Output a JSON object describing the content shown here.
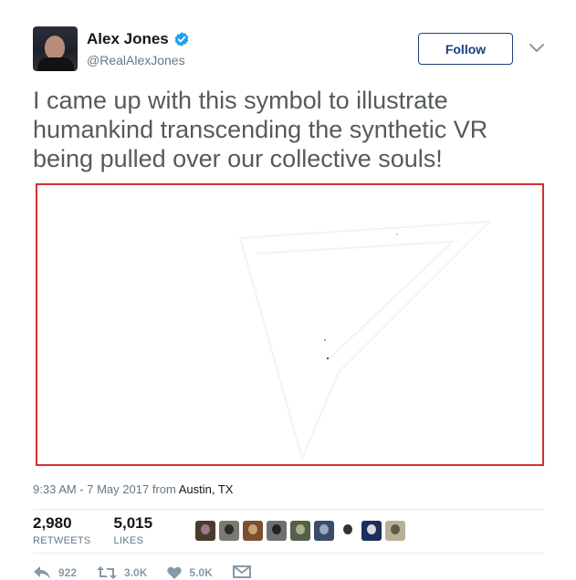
{
  "user": {
    "display_name": "Alex Jones",
    "handle": "@RealAlexJones",
    "verified": true
  },
  "follow_label": "Follow",
  "tweet_text": "I came up with this symbol to illustrate humankind transcending the synthetic VR being pulled over our collective souls!",
  "meta": {
    "time": "9:33 AM - 7 May 2017",
    "from": "from",
    "location": "Austin, TX"
  },
  "stats": {
    "retweets": {
      "value": "2,980",
      "label": "RETWEETS"
    },
    "likes": {
      "value": "5,015",
      "label": "LIKES"
    }
  },
  "likers": [
    {
      "bg": "#4a3b2a",
      "fg": "#9b7a8a"
    },
    {
      "bg": "#7a7a72",
      "fg": "#2b2b2b"
    },
    {
      "bg": "#7c4f2f",
      "fg": "#c9a27a"
    },
    {
      "bg": "#6f6f6f",
      "fg": "#222222"
    },
    {
      "bg": "#55604a",
      "fg": "#a9b08c"
    },
    {
      "bg": "#3a4c6a",
      "fg": "#9aa8c0"
    },
    {
      "bg": "#ffffff",
      "fg": "#333333"
    },
    {
      "bg": "#1c2d5a",
      "fg": "#d9d9d9"
    },
    {
      "bg": "#b6b09a",
      "fg": "#5f5847"
    }
  ],
  "actions": {
    "reply": "922",
    "retweet": "3.0K",
    "like": "5.0K"
  },
  "colors": {
    "accent": "#1d3f78",
    "media_border": "#d32f2f",
    "muted": "#657786",
    "icon": "#8899a6"
  }
}
